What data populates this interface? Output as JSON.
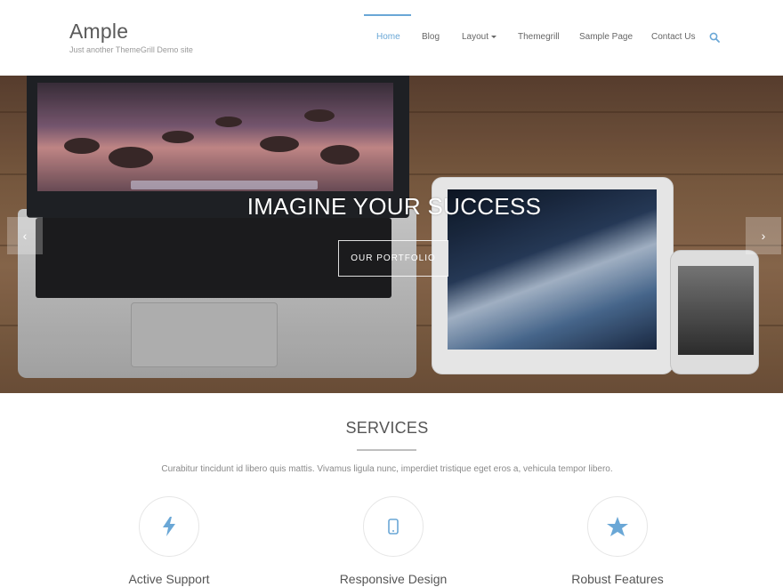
{
  "header": {
    "site_title": "Ample",
    "site_description": "Just another ThemeGrill Demo site",
    "nav": [
      {
        "label": "Home"
      },
      {
        "label": "Blog"
      },
      {
        "label": "Layout"
      },
      {
        "label": "Themegrill"
      },
      {
        "label": "Sample Page"
      },
      {
        "label": "Contact Us"
      }
    ],
    "accent_color": "#6aa7d6",
    "search_icon": "search-icon"
  },
  "hero": {
    "title": "IMAGINE YOUR SUCCESS",
    "button_label": "OUR PORTFOLIO",
    "prev_icon": "‹",
    "next_icon": "›"
  },
  "services": {
    "title": "SERVICES",
    "description": "Curabitur tincidunt id libero quis mattis. Vivamus ligula nunc, imperdiet tristique eget eros a, vehicula tempor libero.",
    "items": [
      {
        "name": "Active Support",
        "icon": "bolt-icon"
      },
      {
        "name": "Responsive Design",
        "icon": "mobile-icon"
      },
      {
        "name": "Robust Features",
        "icon": "star-icon"
      }
    ]
  }
}
